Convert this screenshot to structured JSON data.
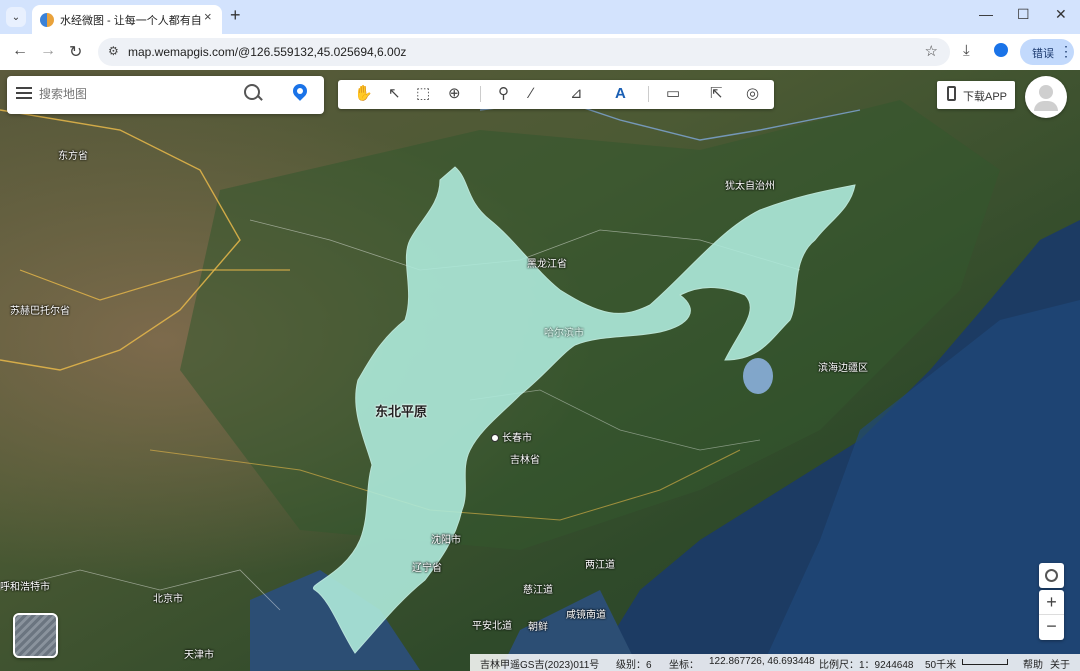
{
  "browser": {
    "tab_title": "水经微图 - 让每一个人都有自己",
    "tab_close": "×",
    "new_tab": "+",
    "tab_list": "⌄",
    "window_minimize": "—",
    "window_maximize": "☐",
    "window_close": "✕",
    "nav_back": "←",
    "nav_forward": "→",
    "nav_reload": "↻",
    "site_info_icon": "⚙",
    "url": "map.wemapgis.com/@126.559132,45.025694,6.00z",
    "star_icon": "☆",
    "download_icon": "⤓",
    "error_label": "错误",
    "menu_dots": "⋮"
  },
  "search": {
    "placeholder": "搜索地图"
  },
  "tools": [
    {
      "name": "pan-hand-icon",
      "glyph": "✋"
    },
    {
      "name": "select-pointer-icon",
      "glyph": "↖"
    },
    {
      "name": "box-select-icon",
      "glyph": "⬚"
    },
    {
      "name": "zoom-search-icon",
      "glyph": "⊕"
    },
    {
      "name": "marker-pin-icon",
      "glyph": "⚲"
    },
    {
      "name": "polyline-icon",
      "glyph": "∕"
    },
    {
      "name": "polygon-icon",
      "glyph": "⊿"
    },
    {
      "name": "text-label-icon",
      "glyph": "A"
    },
    {
      "name": "measure-ruler-icon",
      "glyph": "▭"
    },
    {
      "name": "identify-cursor-icon",
      "glyph": "⇱"
    },
    {
      "name": "globe-icon",
      "glyph": "◎"
    }
  ],
  "download_app": {
    "label": "下载APP"
  },
  "map": {
    "highlight_region_label": "东北平原",
    "labels": [
      {
        "key": "dongfang",
        "text": "东方省"
      },
      {
        "key": "suhebat",
        "text": "苏赫巴托尔省"
      },
      {
        "key": "heilongjiang",
        "text": "黑龙江省"
      },
      {
        "key": "youtai",
        "text": "犹太自治州"
      },
      {
        "key": "binhai",
        "text": "滨海边疆区"
      },
      {
        "key": "harbin",
        "text": "哈尔滨市"
      },
      {
        "key": "changchun",
        "text": "长春市"
      },
      {
        "key": "jilin",
        "text": "吉林省"
      },
      {
        "key": "shenyang",
        "text": "沈阳市"
      },
      {
        "key": "liaoning",
        "text": "辽宁省"
      },
      {
        "key": "pyongan",
        "text": "平安北道"
      },
      {
        "key": "cizhang",
        "text": "慈江道"
      },
      {
        "key": "lianggang",
        "text": "两江道"
      },
      {
        "key": "xianjing",
        "text": "咸镜南道"
      },
      {
        "key": "chaoxian",
        "text": "朝鲜"
      },
      {
        "key": "huhehaote",
        "text": "呼和浩特市"
      },
      {
        "key": "beijing",
        "text": "北京市"
      },
      {
        "key": "tianjin",
        "text": "天津市"
      }
    ]
  },
  "controls": {
    "zoom_in": "+",
    "zoom_out": "−"
  },
  "status": {
    "copyright": "吉林甲遥GS吉(2023)011号",
    "level": "级别：6",
    "coords": "坐标：",
    "coords_value": "122.867726, 46.693448",
    "scale": "比例尺：1：9244648",
    "scale_distance": "50千米",
    "help": "帮助",
    "about": "关于"
  },
  "colors": {
    "highlight_fill": "#aeeadb",
    "accent": "#1a73e8"
  }
}
